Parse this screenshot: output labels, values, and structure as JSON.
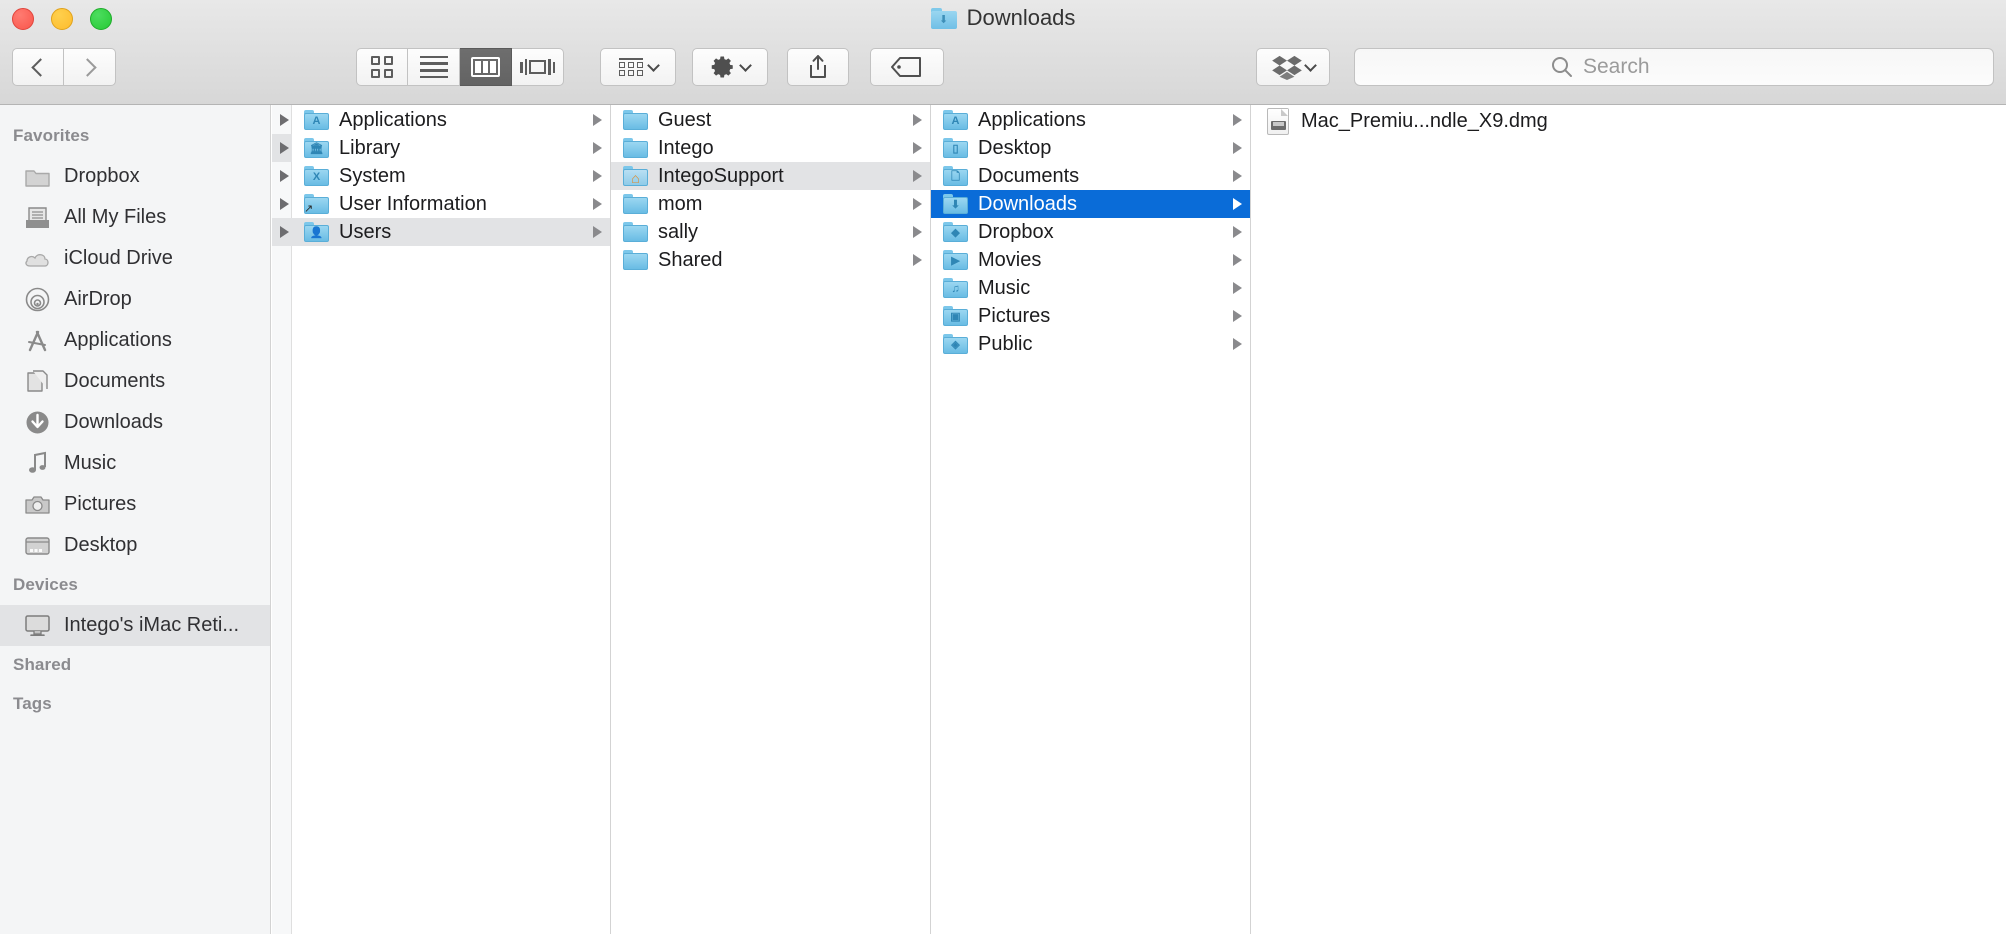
{
  "window": {
    "title": "Downloads",
    "title_icon": "downloads-folder-icon",
    "traffic_lights": [
      "close",
      "minimize",
      "maximize"
    ]
  },
  "toolbar": {
    "back_label": "Back",
    "forward_label": "Forward",
    "view_icon_label": "Icon View",
    "view_list_label": "List View",
    "view_column_label": "Column View",
    "view_cover_label": "Cover Flow View",
    "arrange_label": "Arrange",
    "action_label": "Action",
    "share_label": "Share",
    "tags_label": "Edit Tags",
    "dropbox_label": "Dropbox",
    "active_view": "column"
  },
  "search": {
    "placeholder": "Search",
    "value": "",
    "icon": "search-icon"
  },
  "sidebar": {
    "sections": [
      {
        "title": "Favorites",
        "items": [
          {
            "label": "Dropbox",
            "icon": "folder-icon",
            "selected": false
          },
          {
            "label": "All My Files",
            "icon": "all-my-files-icon",
            "selected": false
          },
          {
            "label": "iCloud Drive",
            "icon": "cloud-icon",
            "selected": false
          },
          {
            "label": "AirDrop",
            "icon": "airdrop-icon",
            "selected": false
          },
          {
            "label": "Applications",
            "icon": "applications-icon",
            "selected": false
          },
          {
            "label": "Documents",
            "icon": "documents-icon",
            "selected": false
          },
          {
            "label": "Downloads",
            "icon": "download-arrow-icon",
            "selected": false
          },
          {
            "label": "Music",
            "icon": "music-note-icon",
            "selected": false
          },
          {
            "label": "Pictures",
            "icon": "camera-icon",
            "selected": false
          },
          {
            "label": "Desktop",
            "icon": "desktop-icon",
            "selected": false
          }
        ]
      },
      {
        "title": "Devices",
        "items": [
          {
            "label": "Intego's iMac Reti...",
            "icon": "imac-display-icon",
            "selected": true
          }
        ]
      },
      {
        "title": "Shared",
        "items": []
      },
      {
        "title": "Tags",
        "items": []
      }
    ]
  },
  "columns": [
    {
      "name": "column-1",
      "rows": [
        {
          "label": "Applications",
          "icon": "applications-folder-icon",
          "glyph": "A",
          "arrow": true,
          "state": "normal"
        },
        {
          "label": "Library",
          "icon": "library-folder-icon",
          "glyph": "ııı",
          "arrow": true,
          "state": "normal"
        },
        {
          "label": "System",
          "icon": "system-folder-icon",
          "glyph": "X",
          "arrow": true,
          "state": "normal"
        },
        {
          "label": "User Information",
          "icon": "alias-folder-icon",
          "glyph": "",
          "arrow": true,
          "state": "normal"
        },
        {
          "label": "Users",
          "icon": "users-folder-icon",
          "glyph": "\u0001",
          "arrow": true,
          "state": "gray"
        }
      ]
    },
    {
      "name": "column-2",
      "rows": [
        {
          "label": "Guest",
          "icon": "folder-icon",
          "glyph": "",
          "arrow": true,
          "state": "normal"
        },
        {
          "label": "Intego",
          "icon": "folder-icon",
          "glyph": "",
          "arrow": true,
          "state": "normal"
        },
        {
          "label": "IntegoSupport",
          "icon": "home-folder-icon",
          "glyph": "",
          "arrow": true,
          "state": "gray"
        },
        {
          "label": "mom",
          "icon": "folder-icon",
          "glyph": "",
          "arrow": true,
          "state": "normal"
        },
        {
          "label": "sally",
          "icon": "folder-icon",
          "glyph": "",
          "arrow": true,
          "state": "normal"
        },
        {
          "label": "Shared",
          "icon": "folder-icon",
          "glyph": "",
          "arrow": true,
          "state": "normal"
        }
      ]
    },
    {
      "name": "column-3",
      "rows": [
        {
          "label": "Applications",
          "icon": "applications-folder-icon",
          "glyph": "A",
          "arrow": true,
          "state": "normal"
        },
        {
          "label": "Desktop",
          "icon": "desktop-folder-icon",
          "glyph": "▭",
          "arrow": true,
          "state": "normal"
        },
        {
          "label": "Documents",
          "icon": "documents-folder-icon",
          "glyph": "▭",
          "arrow": true,
          "state": "normal"
        },
        {
          "label": "Downloads",
          "icon": "downloads-folder-icon",
          "glyph": "⬇",
          "arrow": true,
          "state": "blue"
        },
        {
          "label": "Dropbox",
          "icon": "dropbox-folder-icon",
          "glyph": "⬟",
          "arrow": true,
          "state": "normal"
        },
        {
          "label": "Movies",
          "icon": "movies-folder-icon",
          "glyph": "▶",
          "arrow": true,
          "state": "normal"
        },
        {
          "label": "Music",
          "icon": "music-folder-icon",
          "glyph": "♫",
          "arrow": true,
          "state": "normal"
        },
        {
          "label": "Pictures",
          "icon": "pictures-folder-icon",
          "glyph": "▣",
          "arrow": true,
          "state": "normal"
        },
        {
          "label": "Public",
          "icon": "public-folder-icon",
          "glyph": "◆",
          "arrow": true,
          "state": "normal"
        }
      ]
    },
    {
      "name": "column-4",
      "rows": [
        {
          "label": "Mac_Premiu...ndle_X9.dmg",
          "icon": "disk-image-icon",
          "glyph": "",
          "arrow": false,
          "state": "normal"
        }
      ]
    }
  ],
  "colors": {
    "selection_blue": "#0a6cd8",
    "selection_gray": "#e2e3e5",
    "sidebar_bg": "#f4f5f6",
    "folder_blue": "#86cdeb"
  }
}
